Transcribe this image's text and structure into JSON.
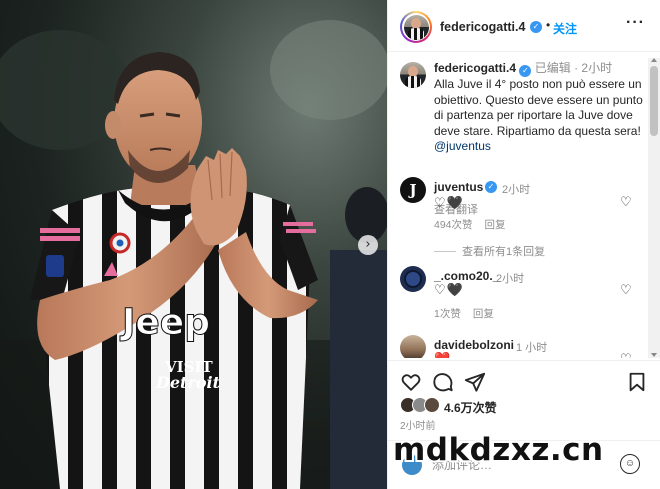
{
  "post": {
    "username": "federicogatti.4",
    "follow_label": "关注",
    "dot": "•",
    "more": "···",
    "carousel_next": "›"
  },
  "jersey": {
    "sponsor": "Jeep",
    "sleeve_text_1": "VISIT",
    "sleeve_text_2": "Detroit"
  },
  "caption": {
    "username": "federicogatti.4",
    "edited": "已编辑",
    "dot": "·",
    "time": "2小时",
    "text": "Alla Juve il 4° posto non può essere un obiettivo. Questo deve essere un punto di partenza per riportare la Juve dove deve stare. Ripartiamo da questa sera! ",
    "mention": "@juventus",
    "see_translation": "查看翻译"
  },
  "comments": [
    {
      "username": "juventus",
      "verified": true,
      "time": "2小时",
      "hearts": "♡🖤",
      "likes": "494次赞",
      "reply": "回复",
      "view_replies": "查看所有1条回复"
    },
    {
      "username": "_.como20._",
      "verified": false,
      "time": "2小时",
      "hearts": "♡🖤",
      "likes": "1次赞",
      "reply": "回复"
    },
    {
      "username": "davidebolzoni",
      "verified": false,
      "time": "1 小时",
      "hearts": "❤️"
    }
  ],
  "actions": {
    "like_icon": "heart-outline-icon",
    "comment_icon": "comment-bubble-icon",
    "share_icon": "paper-plane-icon",
    "save_icon": "bookmark-icon"
  },
  "likes_summary": "4.6万次赞",
  "post_time": "2小时前",
  "add_comment": {
    "placeholder": "添加评论…"
  },
  "watermark": "mdkdzxz.cn",
  "colors": {
    "link_blue": "#0095f6",
    "verified_blue": "#3897f0",
    "muted_text": "#8e8e8e",
    "text": "#262626"
  }
}
